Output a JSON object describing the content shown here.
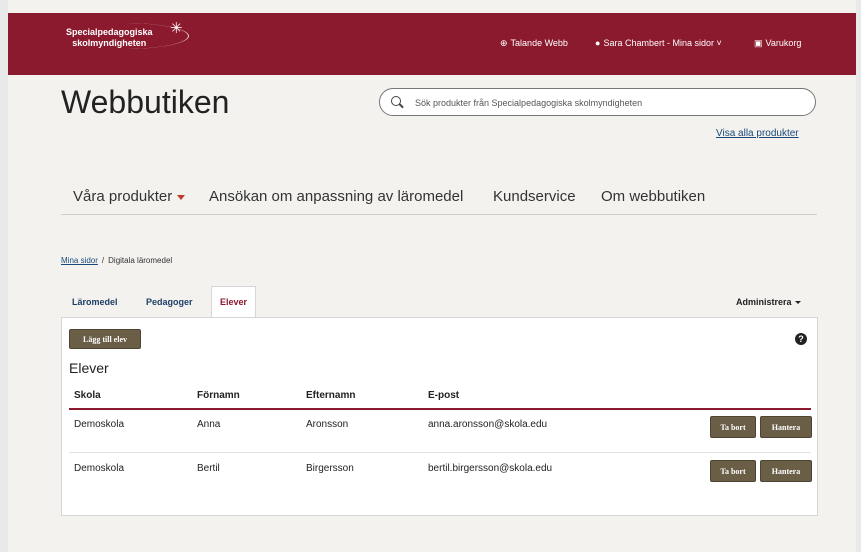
{
  "header": {
    "logo_line1": "Specialpedagogiska",
    "logo_line2": "skolmyndigheten",
    "talande_webb": "Talande Webb",
    "user_menu": "Sara Chambert - Mina sidor",
    "cart": "Varukorg",
    "brand_color": "#8b1a2f"
  },
  "site_title": "Webbutiken",
  "search": {
    "placeholder": "Sök produkter från Specialpedagogiska skolmyndigheten"
  },
  "show_all_link": "Visa alla produkter",
  "nav": {
    "items": [
      "Våra produkter",
      "Ansökan om anpassning av läromedel",
      "Kundservice",
      "Om webbutiken"
    ]
  },
  "breadcrumb": {
    "link": "Mina sidor",
    "separator": "/",
    "current": "Digitala läromedel"
  },
  "tabs": [
    "Läromedel",
    "Pedagoger",
    "Elever"
  ],
  "active_tab": "Elever",
  "admin_menu": "Administrera",
  "panel": {
    "add_button": "Lägg till elev",
    "help_icon": "?",
    "title": "Elever",
    "columns": [
      "Skola",
      "Förnamn",
      "Efternamn",
      "E-post"
    ],
    "rows": [
      [
        "Demoskola",
        "Anna",
        "Aronsson",
        "anna.aronsson@skola.edu"
      ],
      [
        "Demoskola",
        "Bertil",
        "Birgersson",
        "bertil.birgersson@skola.edu"
      ]
    ],
    "delete_label": "Ta bort",
    "manage_label": "Hantera"
  },
  "icons": {
    "logo": "spsm-logo-icon",
    "talande_webb": "speaker-icon",
    "user": "user-icon",
    "cart": "cart-icon",
    "search": "search-icon",
    "nav_dropdown": "chevron-down-icon",
    "admin_dropdown": "chevron-down-icon",
    "help": "help-icon"
  }
}
